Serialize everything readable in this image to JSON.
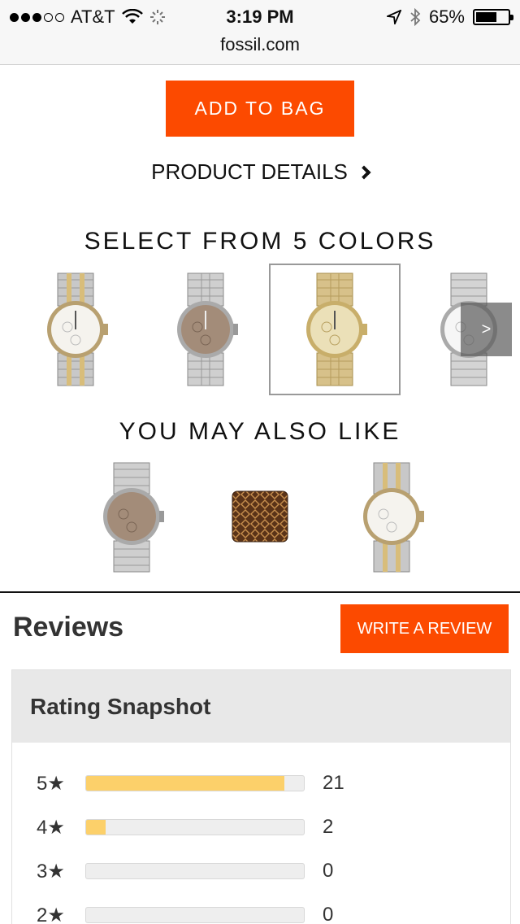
{
  "status_bar": {
    "carrier": "AT&T",
    "time": "3:19 PM",
    "battery": "65%",
    "battery_level": 0.65,
    "signal_bars": 3,
    "icons": [
      "wifi-icon",
      "loading-icon",
      "location-icon",
      "bluetooth-icon",
      "battery-icon"
    ]
  },
  "browser": {
    "url": "fossil.com"
  },
  "product": {
    "add_to_bag_label": "ADD TO BAG",
    "details_label": "PRODUCT DETAILS"
  },
  "colors_section": {
    "title": "SELECT FROM 5 COLORS",
    "swatches": [
      {
        "finish": "two-tone",
        "selected": false
      },
      {
        "finish": "silver-taupe",
        "selected": false
      },
      {
        "finish": "gold",
        "selected": true
      },
      {
        "finish": "silver",
        "selected": false
      }
    ],
    "next_arrow": ">"
  },
  "also_like_section": {
    "title": "YOU MAY ALSO LIKE",
    "items": [
      {
        "type": "watch",
        "finish": "silver-taupe"
      },
      {
        "type": "wallet"
      },
      {
        "type": "watch",
        "finish": "two-tone"
      }
    ]
  },
  "reviews": {
    "title": "Reviews",
    "write_review_label": "WRITE A REVIEW",
    "snapshot_title": "Rating Snapshot",
    "ratings": [
      {
        "label": "5★",
        "count": "21",
        "fraction": 0.91
      },
      {
        "label": "4★",
        "count": "2",
        "fraction": 0.09
      },
      {
        "label": "3★",
        "count": "0",
        "fraction": 0
      },
      {
        "label": "2★",
        "count": "0",
        "fraction": 0
      }
    ]
  },
  "colors": {
    "accent": "#fc4a00",
    "rating_bar": "#fcd06a"
  }
}
